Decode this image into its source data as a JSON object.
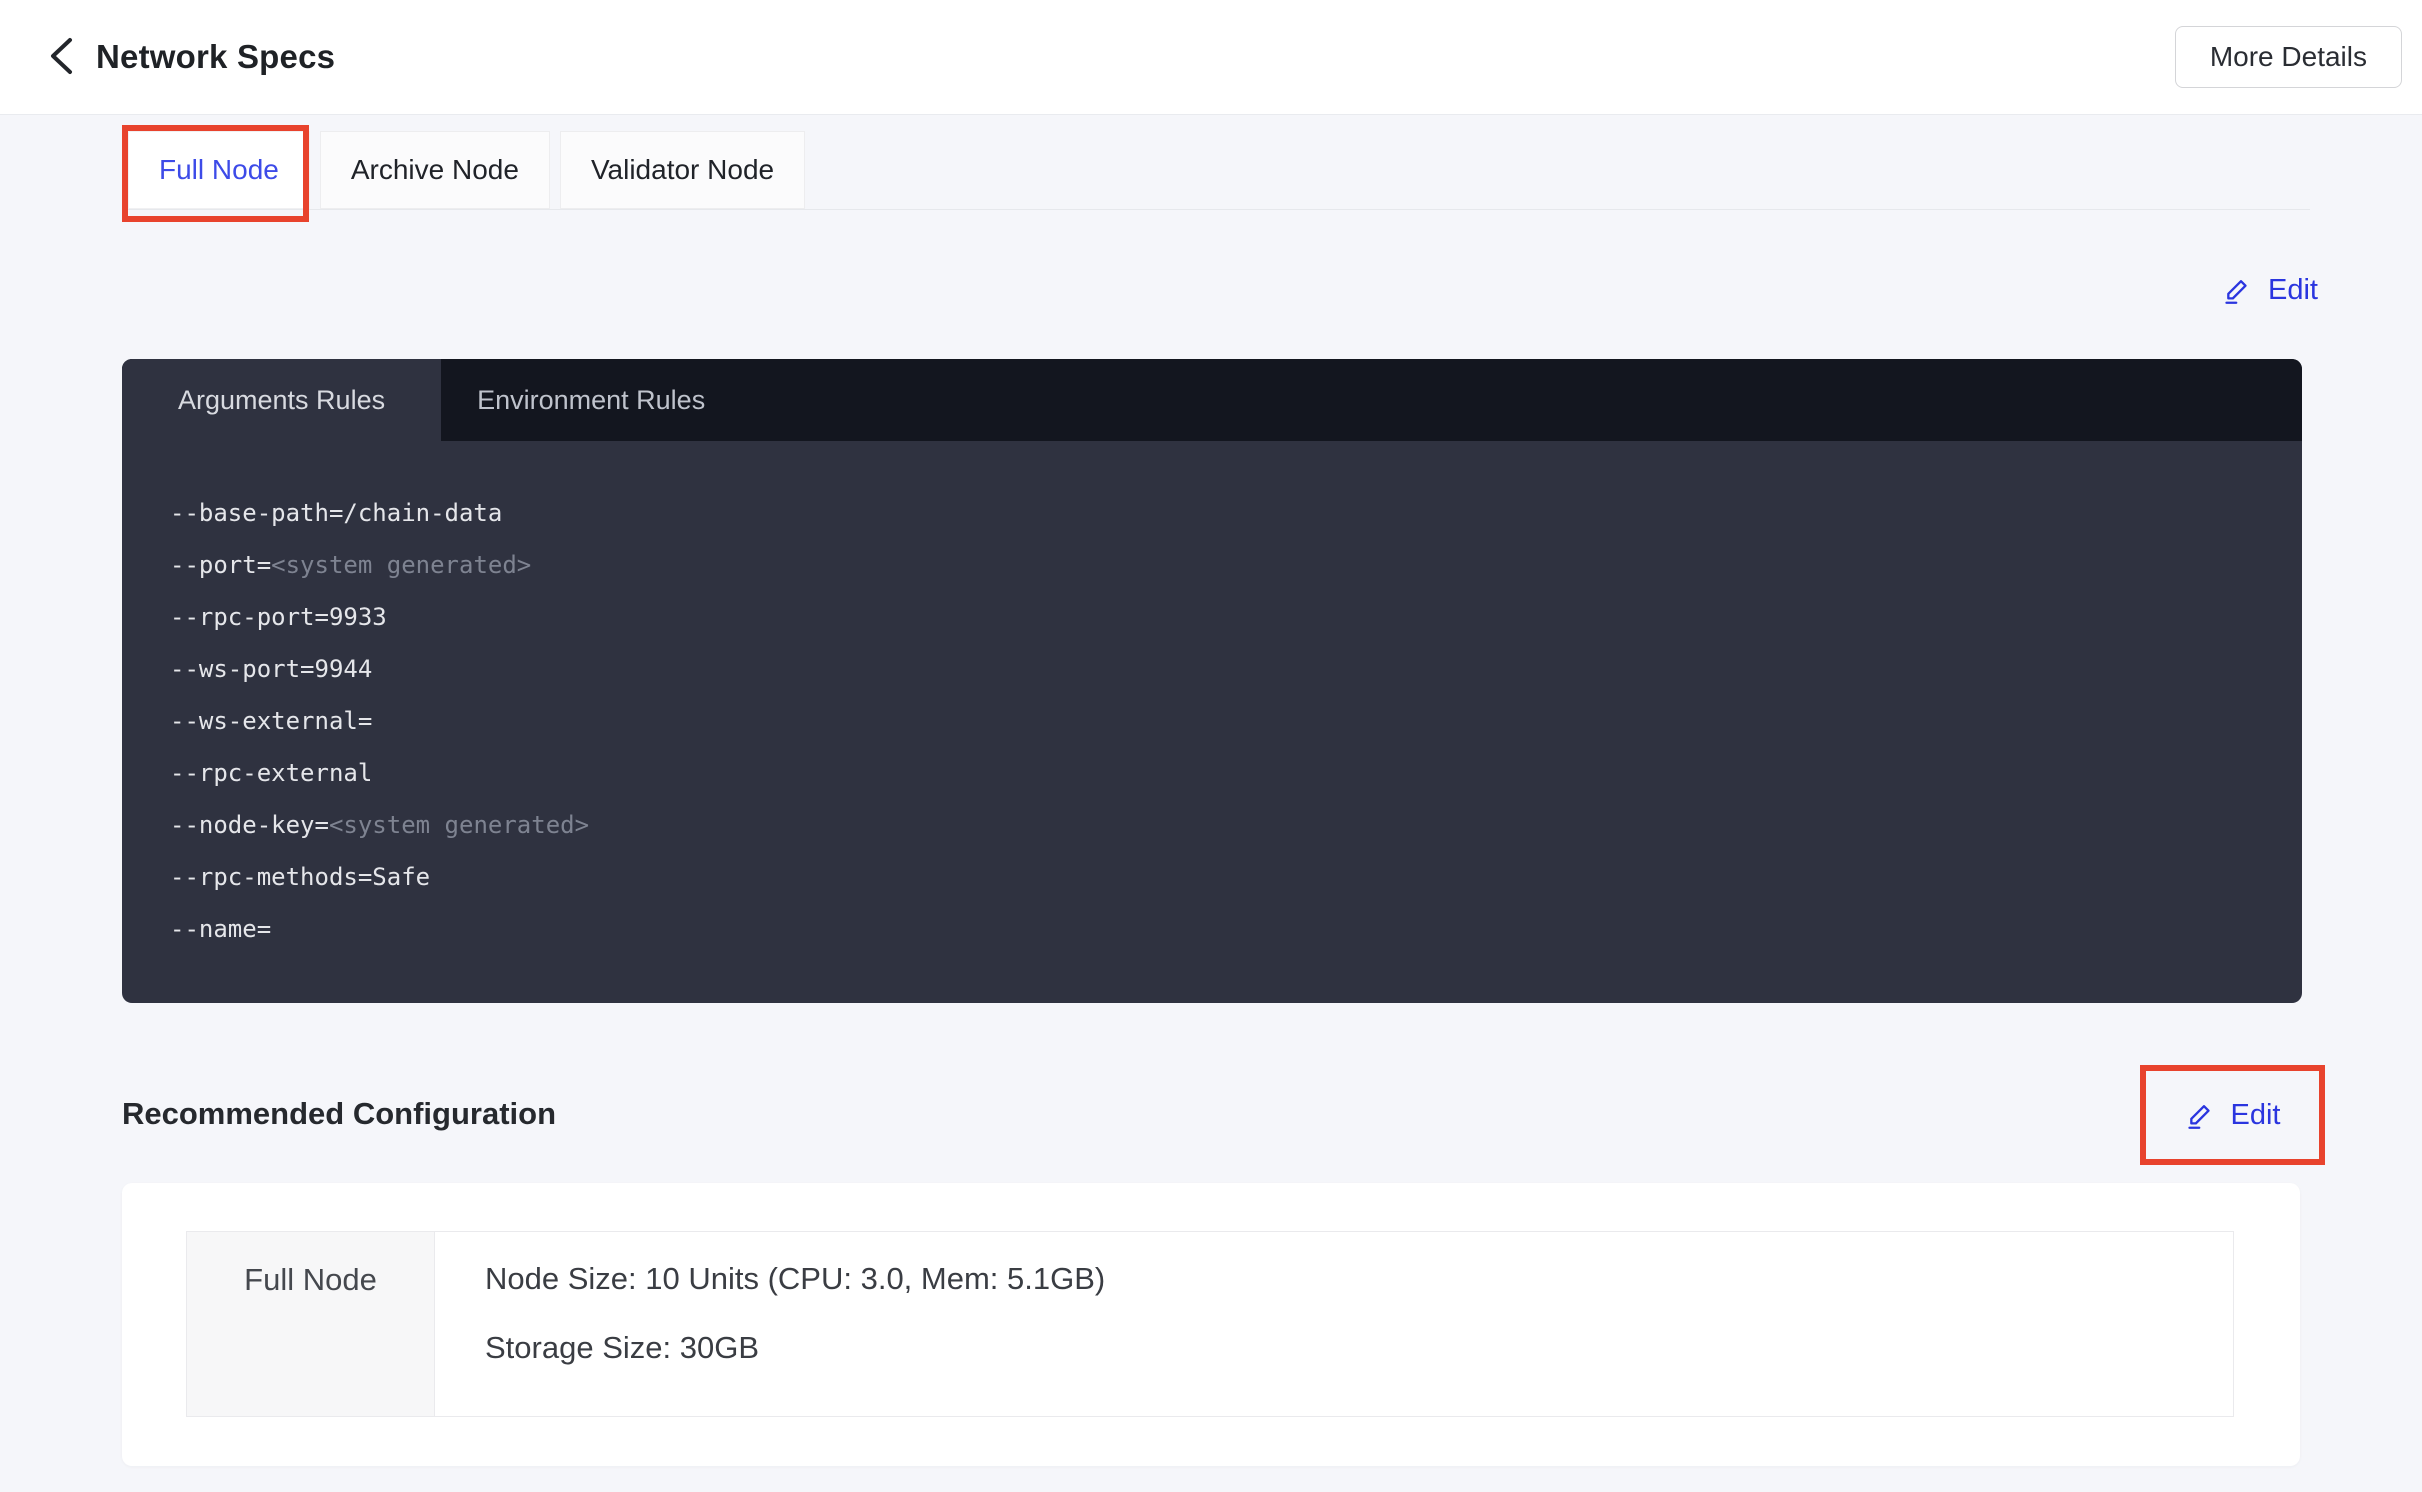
{
  "header": {
    "title": "Network Specs",
    "more_details_label": "More Details"
  },
  "node_tabs": [
    {
      "label": "Full Node",
      "active": true,
      "annotated": true
    },
    {
      "label": "Archive Node",
      "active": false
    },
    {
      "label": "Validator Node",
      "active": false
    }
  ],
  "edit_top": {
    "label": "Edit"
  },
  "rules_panel": {
    "tabs": [
      {
        "label": "Arguments Rules",
        "active": true
      },
      {
        "label": "Environment Rules",
        "active": false
      }
    ],
    "arguments": [
      {
        "text": "--base-path=/chain-data"
      },
      {
        "text": "--port=",
        "dim": "<system generated>"
      },
      {
        "text": "--rpc-port=9933"
      },
      {
        "text": "--ws-port=9944"
      },
      {
        "text": "--ws-external="
      },
      {
        "text": "--rpc-external"
      },
      {
        "text": "--node-key=",
        "dim": "<system generated>"
      },
      {
        "text": "--rpc-methods=Safe"
      },
      {
        "text": "--name="
      }
    ]
  },
  "recommended": {
    "heading": "Recommended Configuration",
    "edit_label": "Edit",
    "row": {
      "label": "Full Node",
      "node_size": "Node Size: 10 Units (CPU: 3.0, Mem: 5.1GB)",
      "storage_size": "Storage Size: 30GB"
    }
  },
  "colors": {
    "accent_blue": "#3D4BE8",
    "edit_blue": "#2A35DF",
    "annotation_red": "#E8432D",
    "panel_body": "#2F3240",
    "panel_strip": "#13161F",
    "page_background": "#F5F6FA"
  }
}
